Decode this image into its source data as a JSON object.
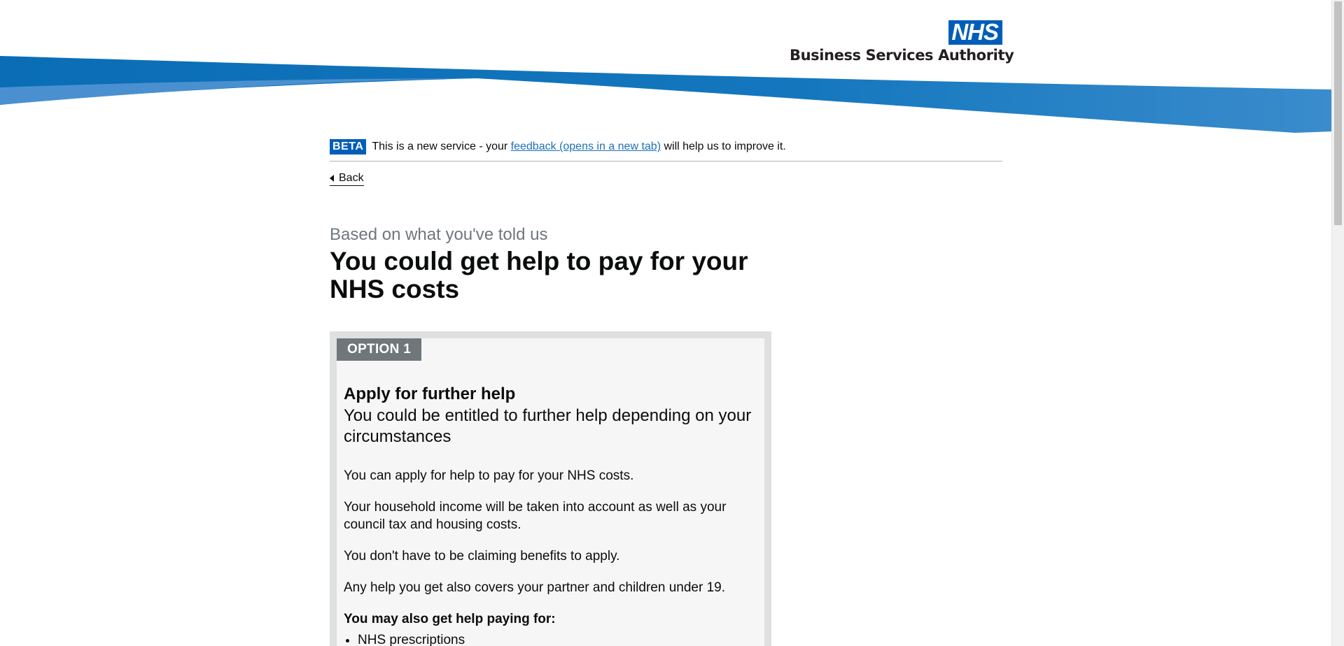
{
  "header": {
    "logo_text": "NHS",
    "organisation": "Business Services Authority",
    "colors": {
      "brand_blue": "#005eb8",
      "swoosh_dark": "#0a6db5",
      "swoosh_light": "#4a90d0"
    }
  },
  "phase_banner": {
    "tag": "BETA",
    "text_before": "This is a new service - your ",
    "link": "feedback (opens in a new tab)",
    "text_after": " will help us to improve it."
  },
  "back_link": {
    "label": "Back"
  },
  "caption": "Based on what you've told us",
  "heading": "You could get help to pay for your NHS costs",
  "option": {
    "tag": "OPTION 1",
    "title": "Apply for further help",
    "subtitle": "You could be entitled to further help depending on your circumstances",
    "paragraphs": [
      "You can apply for help to pay for your NHS costs.",
      "Your household income will be taken into account as well as your council tax and housing costs.",
      "You don't have to be claiming benefits to apply.",
      "Any help you get also covers your partner and children under 19."
    ],
    "list_heading": "You may also get help paying for:",
    "list_items": [
      "NHS prescriptions"
    ]
  }
}
